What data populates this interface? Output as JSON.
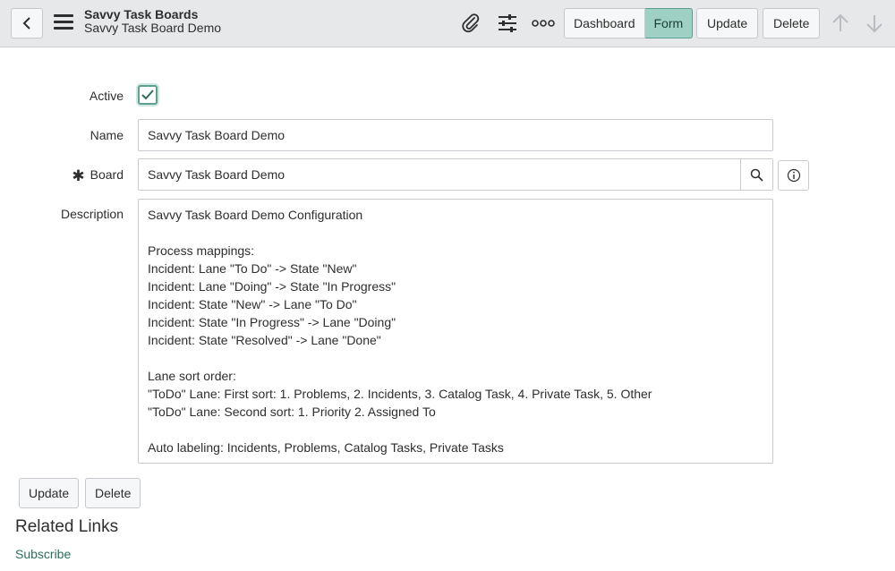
{
  "header": {
    "title": "Savvy Task Boards",
    "subtitle": "Savvy Task Board Demo",
    "icons": {
      "back": "chevron-left-icon",
      "menu": "hamburger-icon",
      "attachment": "paperclip-icon",
      "personalize": "sliders-icon",
      "more": "more-options-icon",
      "previous": "arrow-up-icon",
      "next": "arrow-down-icon"
    },
    "view_tabs": [
      {
        "label": "Dashboard",
        "active": false
      },
      {
        "label": "Form",
        "active": true
      }
    ],
    "update_label": "Update",
    "delete_label": "Delete"
  },
  "form": {
    "active": {
      "label": "Active",
      "checked": true
    },
    "name": {
      "label": "Name",
      "value": "Savvy Task Board Demo"
    },
    "board": {
      "label": "Board",
      "mandatory_marker": "✱",
      "value": "Savvy Task Board Demo"
    },
    "description": {
      "label": "Description",
      "value": "Savvy Task Board Demo Configuration\n\nProcess mappings:\nIncident: Lane \"To Do\" -> State \"New\"\nIncident: Lane \"Doing\" -> State \"In Progress\"\nIncident: State \"New\" -> Lane \"To Do\"\nIncident: State \"In Progress\" -> Lane \"Doing\"\nIncident: State \"Resolved\" -> Lane \"Done\"\n\nLane sort order:\n\"ToDo\" Lane: First sort: 1. Problems, 2. Incidents, 3. Catalog Task, 4. Private Task, 5. Other\n\"ToDo\" Lane: Second sort: 1. Priority 2. Assigned To\n\nAuto labeling: Incidents, Problems, Catalog Tasks, Private Tasks"
    },
    "update_label": "Update",
    "delete_label": "Delete"
  },
  "related_links": {
    "heading": "Related Links",
    "items": [
      {
        "label": "Subscribe"
      }
    ]
  },
  "colors": {
    "header_bg": "#e6e8ea",
    "accent": "#5e9f8f",
    "active_tab_bg": "#9ed0c4",
    "link": "#2a6f5e"
  }
}
